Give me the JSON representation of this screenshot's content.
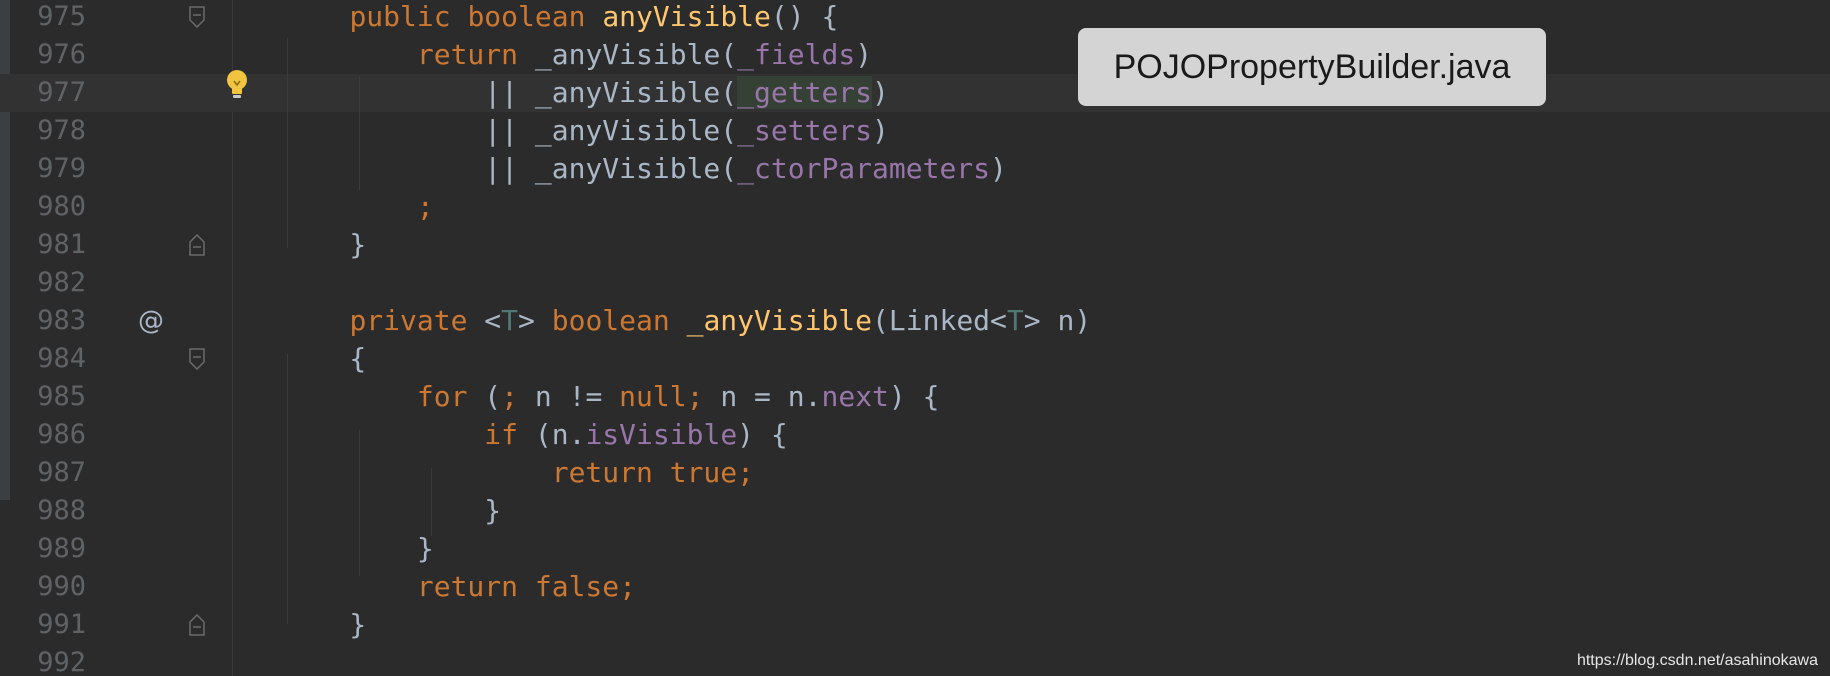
{
  "file_tooltip": "POJOPropertyBuilder.java",
  "watermark": "https://blog.csdn.net/asahinokawa",
  "gutter_icons": {
    "annotation": "@",
    "intention": "lightbulb-icon",
    "fold": "fold-marker-icon"
  },
  "colors": {
    "background": "#2b2b2b",
    "line_number": "#606366",
    "keyword": "#cc7832",
    "method": "#ffc66d",
    "field": "#9876aa",
    "type_param": "#507874",
    "default_text": "#a9b7c6"
  },
  "lines": [
    {
      "num": "975",
      "tokens": [
        [
          "",
          "    "
        ],
        [
          "kw",
          "public boolean "
        ],
        [
          "fn",
          "anyVisible"
        ],
        [
          "",
          "() {"
        ]
      ]
    },
    {
      "num": "976",
      "tokens": [
        [
          "",
          "        "
        ],
        [
          "kw",
          "return "
        ],
        [
          "",
          "_anyVisible("
        ],
        [
          "fld",
          "_fields"
        ],
        [
          "",
          ")"
        ]
      ]
    },
    {
      "num": "977",
      "tokens": [
        [
          "",
          "            || _anyVisible("
        ],
        [
          "fld hl",
          "_getters"
        ],
        [
          "",
          ")"
        ]
      ]
    },
    {
      "num": "978",
      "tokens": [
        [
          "",
          "            || _anyVisible("
        ],
        [
          "fld",
          "_setters"
        ],
        [
          "",
          ")"
        ]
      ]
    },
    {
      "num": "979",
      "tokens": [
        [
          "",
          "            || _anyVisible("
        ],
        [
          "fld",
          "_ctorParameters"
        ],
        [
          "",
          ")"
        ]
      ]
    },
    {
      "num": "980",
      "tokens": [
        [
          "",
          "        "
        ],
        [
          "kw",
          ";"
        ]
      ]
    },
    {
      "num": "981",
      "tokens": [
        [
          "",
          "    }"
        ]
      ]
    },
    {
      "num": "982",
      "tokens": []
    },
    {
      "num": "983",
      "tokens": [
        [
          "",
          "    "
        ],
        [
          "kw",
          "private "
        ],
        [
          "",
          "<"
        ],
        [
          "tp",
          "T"
        ],
        [
          "",
          "> "
        ],
        [
          "kw",
          "boolean "
        ],
        [
          "fn",
          "_anyVisible"
        ],
        [
          "",
          "(Linked<"
        ],
        [
          "tp",
          "T"
        ],
        [
          "",
          "> n)"
        ]
      ]
    },
    {
      "num": "984",
      "tokens": [
        [
          "",
          "    {"
        ]
      ]
    },
    {
      "num": "985",
      "tokens": [
        [
          "",
          "        "
        ],
        [
          "kw",
          "for "
        ],
        [
          "",
          "("
        ],
        [
          "kw",
          "; "
        ],
        [
          "",
          "n != "
        ],
        [
          "kw",
          "null; "
        ],
        [
          "",
          "n = n."
        ],
        [
          "fld",
          "next"
        ],
        [
          "",
          ") {"
        ]
      ]
    },
    {
      "num": "986",
      "tokens": [
        [
          "",
          "            "
        ],
        [
          "kw",
          "if "
        ],
        [
          "",
          "(n."
        ],
        [
          "fld",
          "isVisible"
        ],
        [
          "",
          ") {"
        ]
      ]
    },
    {
      "num": "987",
      "tokens": [
        [
          "",
          "                "
        ],
        [
          "kw",
          "return true;"
        ]
      ]
    },
    {
      "num": "988",
      "tokens": [
        [
          "",
          "            }"
        ]
      ]
    },
    {
      "num": "989",
      "tokens": [
        [
          "",
          "        }"
        ]
      ]
    },
    {
      "num": "990",
      "tokens": [
        [
          "",
          "        "
        ],
        [
          "kw",
          "return false;"
        ]
      ]
    },
    {
      "num": "991",
      "tokens": [
        [
          "",
          "    }"
        ]
      ]
    },
    {
      "num": "992",
      "tokens": []
    }
  ]
}
